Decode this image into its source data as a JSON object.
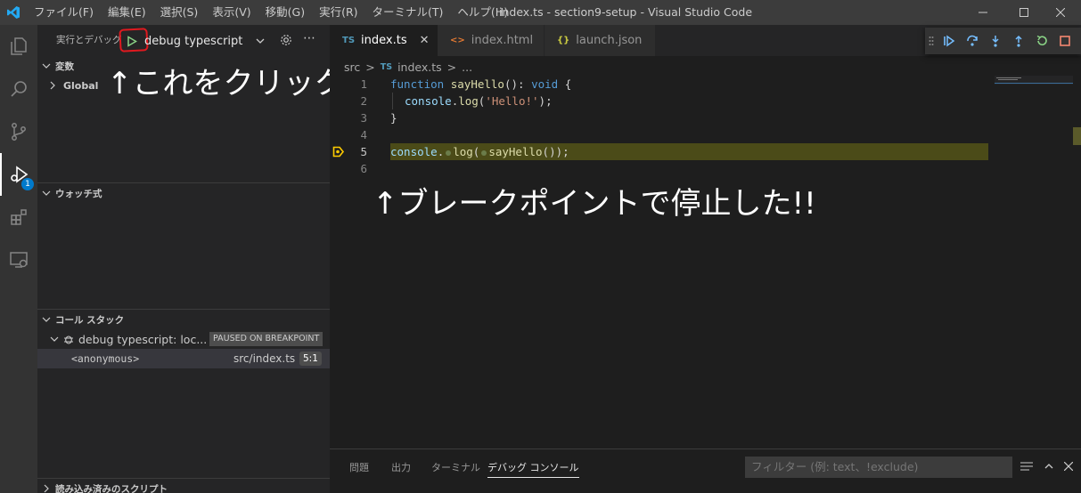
{
  "titlebar": {
    "menu": [
      "ファイル(F)",
      "編集(E)",
      "選択(S)",
      "表示(V)",
      "移動(G)",
      "実行(R)",
      "ターミナル(T)",
      "ヘルプ(H)"
    ],
    "title": "index.ts - section9-setup - Visual Studio Code"
  },
  "activitybar": {
    "debug_badge": "1"
  },
  "sidebar": {
    "title": "実行とデバッグ",
    "config_label": "debug typescript",
    "variables_header": "変数",
    "global_label": "Global",
    "watch_header": "ウォッチ式",
    "callstack_header": "コール スタック",
    "session_label": "debug typescript: loc...",
    "session_status": "PAUSED ON BREAKPOINT",
    "frame_name": "<anonymous>",
    "frame_file": "src/index.ts",
    "frame_pos": "5:1",
    "scripts_header": "読み込み済みのスクリプト"
  },
  "annotations": {
    "click_here": "↑これをクリック",
    "stopped": "↑ブレークポイントで停止した!!"
  },
  "editor": {
    "tabs": [
      {
        "label": "index.ts",
        "icon": "TS"
      },
      {
        "label": "index.html",
        "icon": "<>"
      },
      {
        "label": "launch.json",
        "icon": "{}"
      }
    ],
    "breadcrumb": [
      "src",
      ">",
      "TS",
      "index.ts",
      ">",
      "..."
    ],
    "line_numbers": [
      "1",
      "2",
      "3",
      "4",
      "5",
      "6"
    ],
    "code": {
      "l1_kw": "function",
      "l1_fn": "sayHello",
      "l1_rest": "(): ",
      "l1_type": "void",
      "l1_brace": " {",
      "l2_obj": "console",
      "l2_fn": "log",
      "l2_str": "'Hello!'",
      "l3": "}",
      "l5_obj": "console",
      "l5_fn": "log",
      "l5_call": "sayHello"
    }
  },
  "panel": {
    "tabs": [
      "問題",
      "出力",
      "ターミナル",
      "デバッグ コンソール"
    ],
    "filter_placeholder": "フィルター (例: text、!exclude)"
  },
  "colors": {
    "accent": "#007acc",
    "breakpoint_highlight": "#4b4b18",
    "annotation_red": "#e0191f"
  }
}
